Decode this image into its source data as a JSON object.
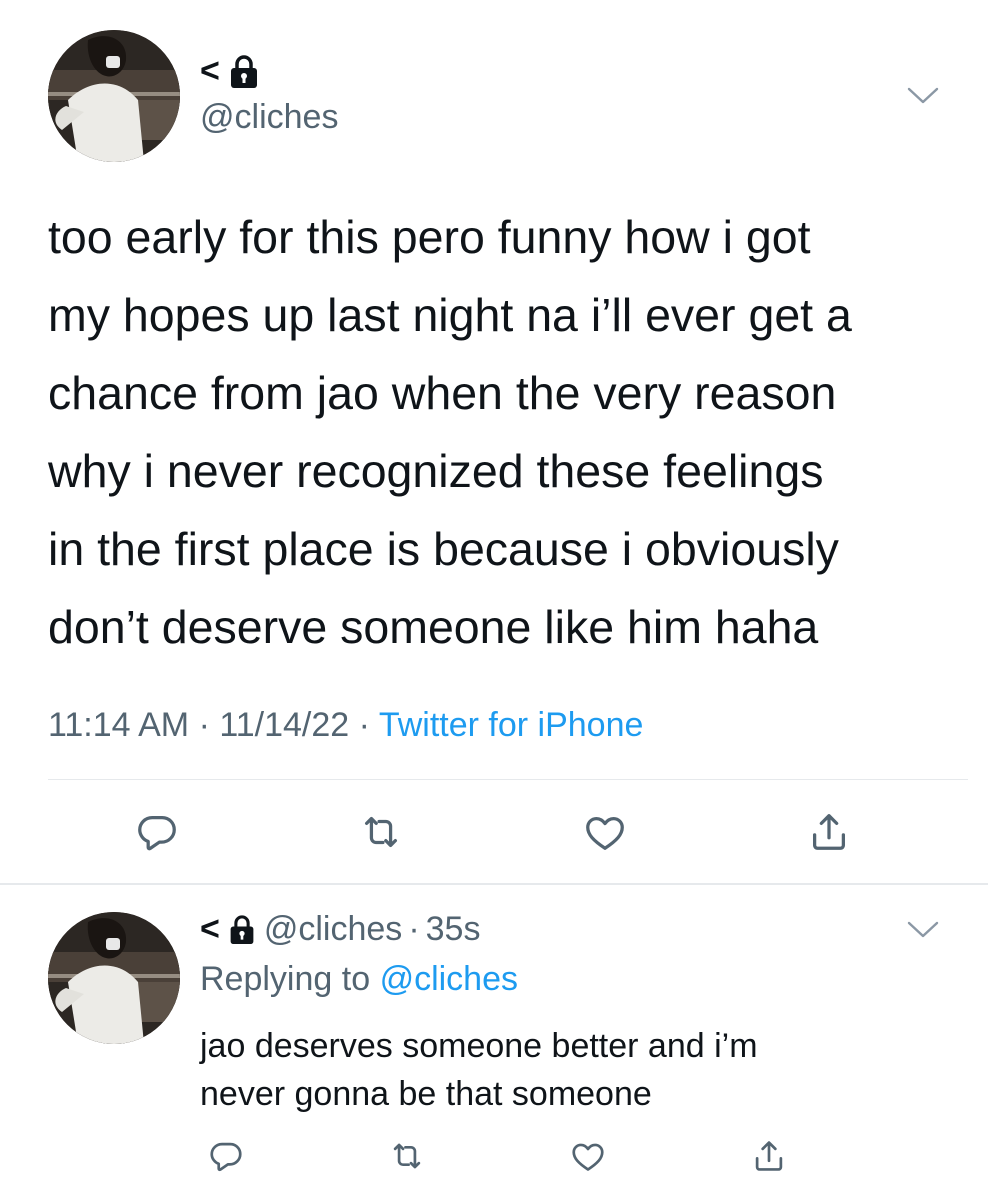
{
  "main_tweet": {
    "display_name": "<",
    "handle": "@cliches",
    "text": "too early for this pero funny how i got\nmy hopes up last night na i’ll ever get a\nchance from jao when the very reason\nwhy i never recognized these feelings\nin the first place is because i obviously\ndon’t deserve someone like him haha",
    "time": "11:14 AM",
    "date": "11/14/22",
    "separator": "·",
    "source": "Twitter for iPhone"
  },
  "reply_tweet": {
    "display_name": "<",
    "handle": "@cliches",
    "separator": "·",
    "age": "35s",
    "replying_prefix": "Replying to",
    "replying_to": "@cliches",
    "text": "jao deserves someone better and i’m\nnever gonna be that someone"
  },
  "icons": {
    "lock": "lock-icon",
    "chevron": "chevron-down-icon",
    "reply": "reply-icon",
    "retweet": "retweet-icon",
    "like": "heart-icon",
    "share": "share-icon"
  },
  "colors": {
    "text": "#0f1419",
    "secondary": "#536471",
    "link": "#1d9bf0",
    "divider": "#e6e9ec"
  }
}
